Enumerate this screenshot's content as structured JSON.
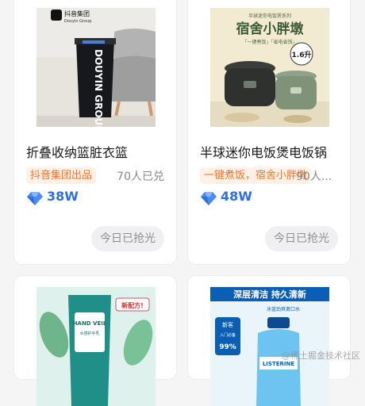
{
  "products": [
    {
      "title": "折叠收纳篮脏衣篮",
      "tag": "抖音集团出品",
      "redeemed": "70人已兑",
      "points": "38W",
      "status": "今日已抢光",
      "brand_logo_text": "抖音集团",
      "brand_logo_sub": "Douyin Group",
      "basket_text": "DOUYIN GROUP"
    },
    {
      "title": "半球迷你电饭煲电饭锅",
      "tag": "一键煮饭，宿舍小胖墩",
      "redeemed": "90人...",
      "points": "48W",
      "status": "今日已抢光",
      "poster_top": "半球迷你电饭煲系列",
      "poster_title": "宿舍小胖墩",
      "poster_sub": "「一键煮饭」「省电省钱」",
      "poster_badge": "1.6升"
    },
    {
      "poster_badge": "新配方!",
      "product_text": "HAND VEIL",
      "product_sub": "水感护手乳"
    },
    {
      "poster_title": "深层清洁 持久清新",
      "poster_sub": "冰蓝劲爽漱口水",
      "badge_top": "新客",
      "badge_mid": "入门必备",
      "badge_pct": "99%",
      "product_text": "LISTERINE"
    }
  ],
  "watermark": "@稀土掘金技术社区",
  "colors": {
    "accent_blue": "#2f6fe4",
    "tag_orange": "#f0742f",
    "tag_bg": "#fff1e6",
    "muted_gray": "#8f8f8f"
  },
  "icons": [
    "points-gem-icon"
  ]
}
